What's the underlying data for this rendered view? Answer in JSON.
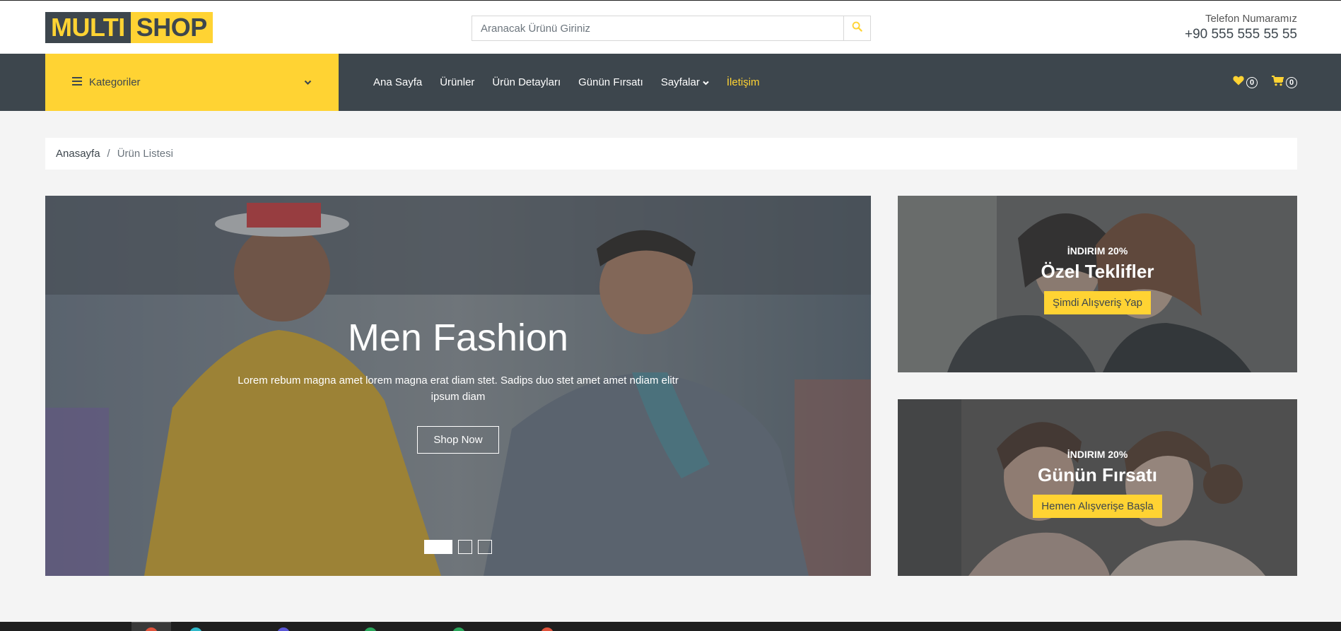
{
  "header": {
    "logo_part1": "MULTI",
    "logo_part2": "SHOP",
    "search_placeholder": "Aranacak Ürünü Giriniz",
    "search_icon": "search-icon",
    "phone_label": "Telefon Numaramız",
    "phone_number": "+90 555 555 55 55"
  },
  "navbar": {
    "categories_label": "Kategoriler",
    "links": [
      "Ana Sayfa",
      "Ürünler",
      "Ürün Detayları",
      "Günün Fırsatı",
      "Sayfalar",
      "İletişim"
    ],
    "active_link": "İletişim",
    "wishlist_count": "0",
    "cart_count": "0"
  },
  "breadcrumb": {
    "home": "Anasayfa",
    "separator": "/",
    "current": "Ürün Listesi"
  },
  "hero": {
    "title": "Men Fashion",
    "description": "Lorem rebum magna amet lorem magna erat diam stet. Sadips duo stet amet amet ndiam elitr ipsum diam",
    "button": "Shop Now",
    "slides": 3,
    "active_slide": 1
  },
  "promos": [
    {
      "tag": "İNDIRIM 20%",
      "title": "Özel Teklifler",
      "button": "Şimdi Alışveriş Yap"
    },
    {
      "tag": "İNDIRIM 20%",
      "title": "Günün Fırsatı",
      "button": "Hemen Alışverişe Başla"
    }
  ],
  "colors": {
    "primary": "#ffd333",
    "dark": "#3d464d",
    "background": "#f4f4f4"
  }
}
